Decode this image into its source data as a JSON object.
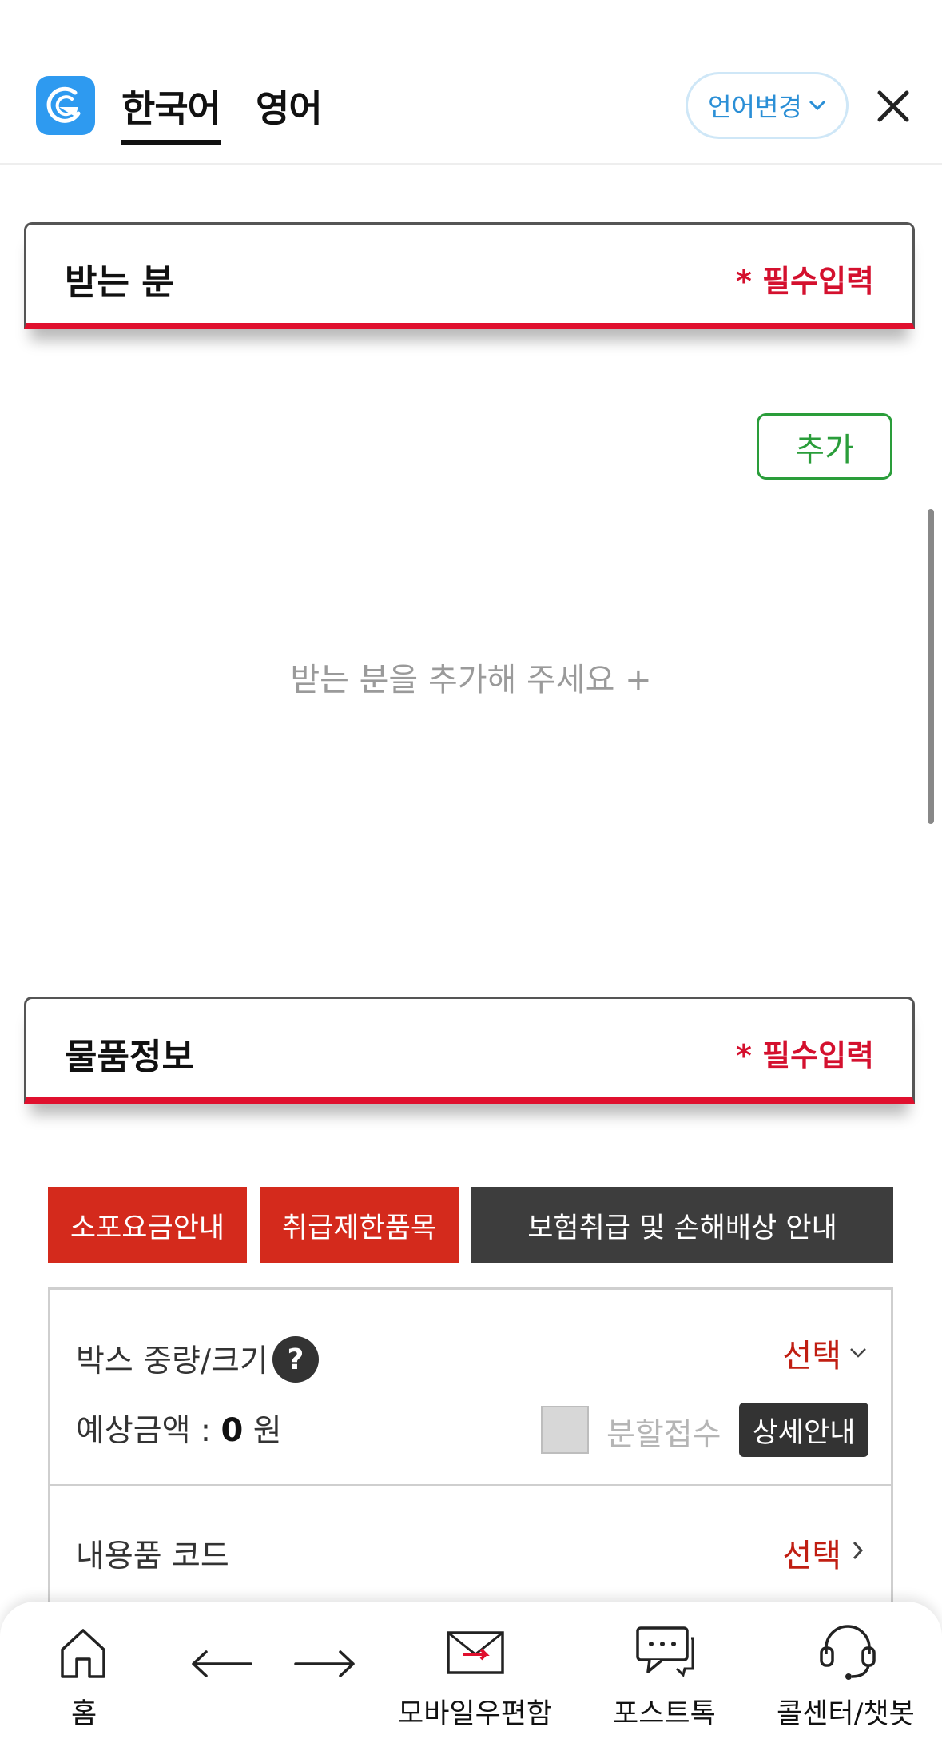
{
  "header": {
    "tabs": [
      {
        "label": "한국어",
        "active": true
      },
      {
        "label": "영어",
        "active": false
      }
    ],
    "language_button": "언어변경",
    "logo_color": "#2e9af0"
  },
  "recipient_section": {
    "title": "받는 분",
    "required": "* 필수입력",
    "add_button": "추가",
    "empty_message": "받는 분을 추가해 주세요 +"
  },
  "item_section": {
    "title": "물품정보",
    "required": "* 필수입력",
    "buttons": [
      "소포요금안내",
      "취급제한품목",
      "보험취급 및 손해배상 안내"
    ],
    "box_row": {
      "label": "박스 중량/크기",
      "help": "?",
      "select": "선택",
      "estimate_label": "예상금액 : ",
      "estimate_value": "0",
      "estimate_unit": " 원",
      "split_label": "분할접수",
      "split_checked": false,
      "detail_button": "상세안내"
    },
    "content_row": {
      "label": "내용품 코드",
      "select": "선택"
    }
  },
  "bottom_nav": {
    "items": [
      "홈",
      "모바일우편함",
      "포스트톡",
      "콜센터/챗봇"
    ]
  },
  "colors": {
    "accent_red": "#e0102e",
    "button_red": "#d42a1c",
    "button_dark": "#3d3d3d",
    "add_green": "#2a9d3a",
    "link_blue": "#2b8fd6"
  }
}
